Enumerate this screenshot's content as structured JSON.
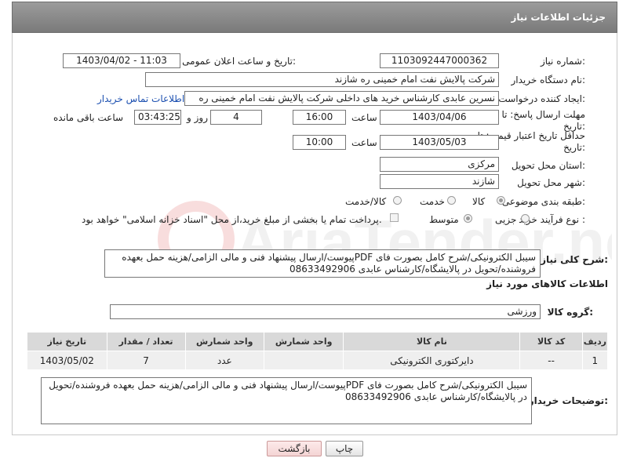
{
  "header": {
    "title": "جزئیات اطلاعات نیاز"
  },
  "fields": {
    "need_number_label": "شماره نیاز:",
    "need_number": "1103092447000362",
    "announce_label": "تاریخ و ساعت اعلان عمومی:",
    "announce_value": "1403/04/02 - 11:03",
    "buyer_org_label": "نام دستگاه خریدار:",
    "buyer_org": "شرکت پالایش نفت امام خمینی  ره  شازند",
    "creator_label": "ایجاد کننده درخواست:",
    "creator": "نسرین عابدی کارشناس خرید های داخلی  شرکت پالایش نفت امام خمینی  ره",
    "contact_link": "اطلاعات تماس خریدار",
    "send_deadline_label": "مهلت ارسال پاسخ: تا",
    "send_deadline_label2": "تاریخ:",
    "send_date": "1403/04/06",
    "time_label": "ساعت",
    "send_time": "16:00",
    "days_value": "4",
    "days_label": "روز و",
    "remaining_value": "03:43:25",
    "remaining_label": "ساعت باقی مانده",
    "price_deadline_label": "حداقل تاریخ اعتبار قیمت: تا",
    "price_deadline_label2": "تاریخ:",
    "price_date": "1403/05/03",
    "price_time": "10:00",
    "province_label": "استان محل تحویل:",
    "province": "مرکزی",
    "city_label": "شهر محل تحویل:",
    "city": "شازند",
    "category_label": "طبقه بندی موضوعی:",
    "category_options": [
      "کالا",
      "خدمت",
      "کالا/خدمت"
    ],
    "process_label": "نوع فرآیند خرید :",
    "process_options": [
      "جزیی",
      "متوسط"
    ],
    "payment_note": "پرداخت تمام یا بخشی از مبلغ خرید،از محل \"اسناد خزانه اسلامی\" خواهد بود."
  },
  "summary": {
    "label": "شرح کلی نیاز:",
    "text": "سیبل الکترونیکی/شرح کامل بصورت فای PDFپیوست/ارسال پیشنهاد فنی و مالی الزامی/هزینه حمل بعهده فروشنده/تحویل در پالایشگاه/کارشناس عابدی 08633492906"
  },
  "goods_section_title": "اطلاعات کالاهای مورد نیاز",
  "goods_group": {
    "label": "گروه کالا:",
    "value": "ورزشی"
  },
  "table": {
    "headers": [
      "ردیف",
      "کد کالا",
      "نام کالا",
      "واحد شمارش",
      "تعداد / مقدار",
      "تاریخ نیاز"
    ],
    "rows": [
      [
        "1",
        "--",
        "دایرکتوری الکترونیکی",
        "عدد",
        "7",
        "1403/05/02"
      ]
    ]
  },
  "buyer_notes": {
    "label": "توضیحات خریدار:",
    "text": "سیبل الکترونیکی/شرح کامل بصورت فای PDFپیوست/ارسال پیشنهاد فنی و مالی الزامی/هزینه حمل بعهده فروشنده/تحویل در پالایشگاه/کارشناس عابدی 08633492906"
  },
  "buttons": {
    "print": "چاپ",
    "back": "بازگشت"
  },
  "watermark_text": "AriaTender.neT"
}
